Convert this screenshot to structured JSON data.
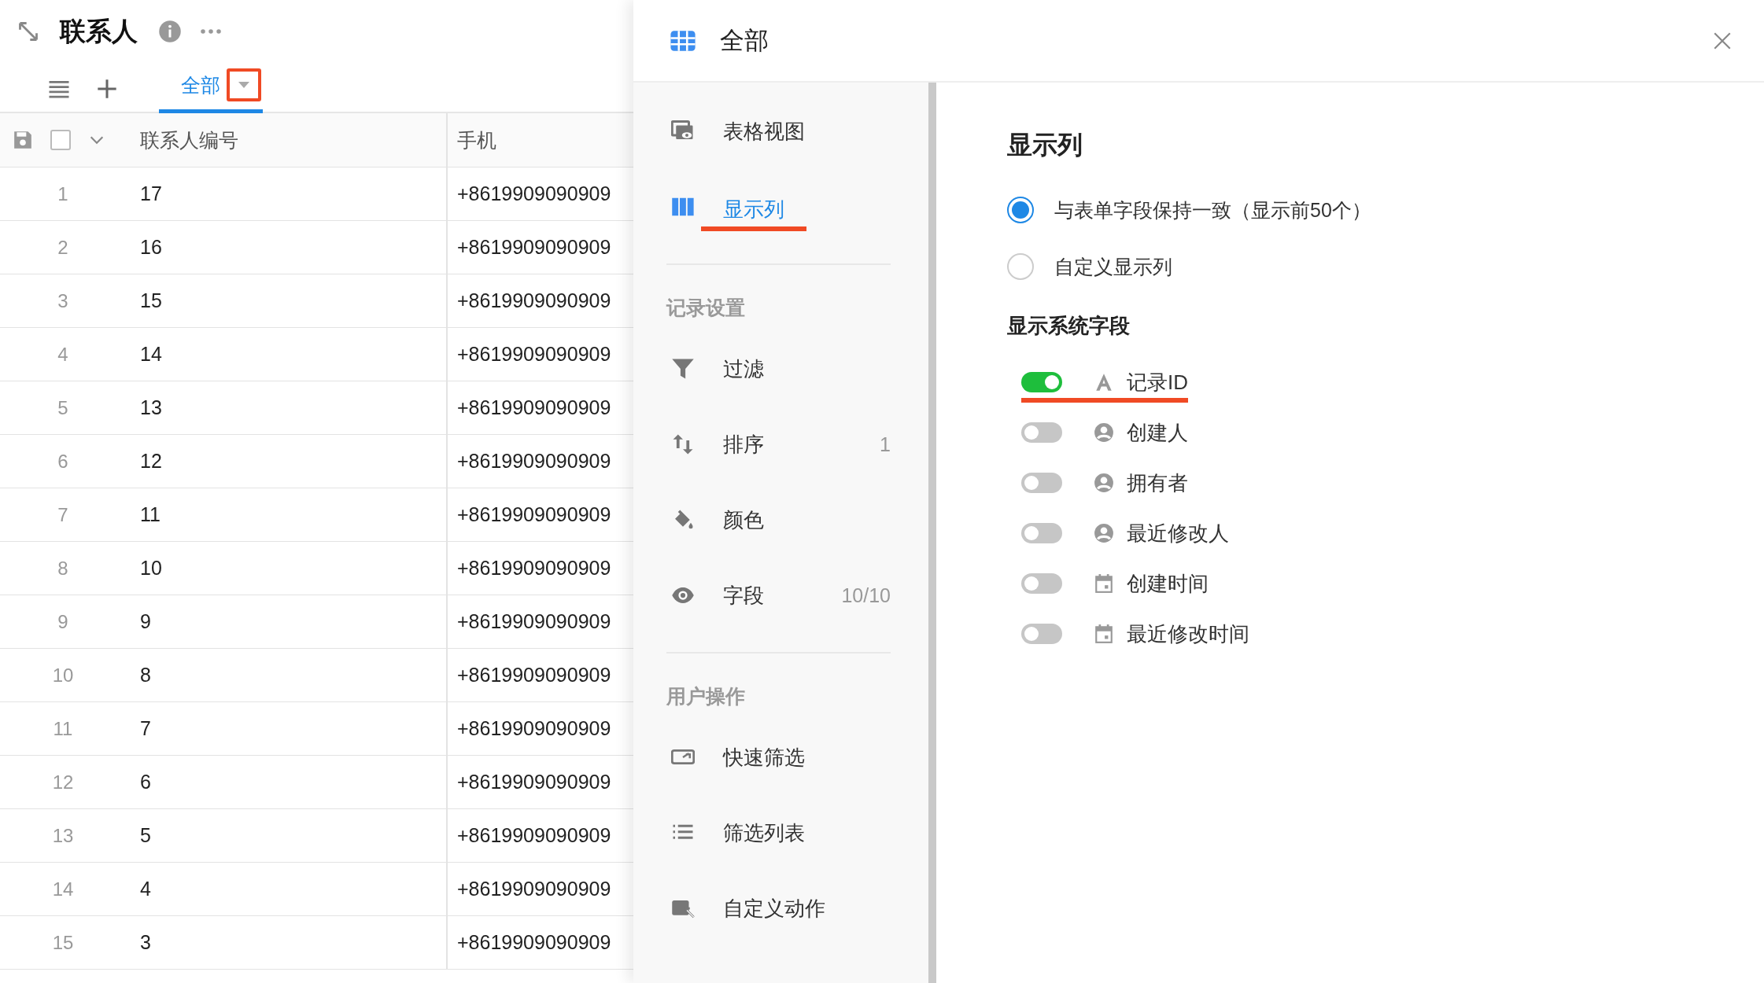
{
  "header": {
    "title": "联系人"
  },
  "view_tabs": [
    {
      "label": "全部",
      "selected": true,
      "highlighted": true
    }
  ],
  "table": {
    "select_all": {
      "checked": false
    },
    "columns": [
      "联系人编号",
      "手机"
    ],
    "rows": [
      {
        "index": "1",
        "number": "17",
        "phone": "+8619909090909"
      },
      {
        "index": "2",
        "number": "16",
        "phone": "+8619909090909"
      },
      {
        "index": "3",
        "number": "15",
        "phone": "+8619909090909"
      },
      {
        "index": "4",
        "number": "14",
        "phone": "+8619909090909"
      },
      {
        "index": "5",
        "number": "13",
        "phone": "+8619909090909"
      },
      {
        "index": "6",
        "number": "12",
        "phone": "+8619909090909"
      },
      {
        "index": "7",
        "number": "11",
        "phone": "+8619909090909"
      },
      {
        "index": "8",
        "number": "10",
        "phone": "+8619909090909"
      },
      {
        "index": "9",
        "number": "9",
        "phone": "+8619909090909"
      },
      {
        "index": "10",
        "number": "8",
        "phone": "+8619909090909"
      },
      {
        "index": "11",
        "number": "7",
        "phone": "+8619909090909"
      },
      {
        "index": "12",
        "number": "6",
        "phone": "+8619909090909"
      },
      {
        "index": "13",
        "number": "5",
        "phone": "+8619909090909"
      },
      {
        "index": "14",
        "number": "4",
        "phone": "+8619909090909"
      },
      {
        "index": "15",
        "number": "3",
        "phone": "+8619909090909"
      }
    ]
  },
  "drawer": {
    "title": "全部",
    "nav": [
      {
        "kind": "item",
        "label": "表格视图",
        "selected": false,
        "highlighted": false
      },
      {
        "kind": "item",
        "label": "显示列",
        "selected": true,
        "highlighted": true
      },
      {
        "kind": "divider"
      },
      {
        "kind": "section",
        "label": "记录设置"
      },
      {
        "kind": "item",
        "label": "过滤",
        "selected": false,
        "highlighted": false
      },
      {
        "kind": "item",
        "label": "排序",
        "count": "1",
        "selected": false,
        "highlighted": false
      },
      {
        "kind": "item",
        "label": "颜色",
        "selected": false,
        "highlighted": false
      },
      {
        "kind": "item",
        "label": "字段",
        "count": "10/10",
        "selected": false,
        "highlighted": false
      },
      {
        "kind": "divider"
      },
      {
        "kind": "section",
        "label": "用户操作"
      },
      {
        "kind": "item",
        "label": "快速筛选",
        "selected": false,
        "highlighted": false
      },
      {
        "kind": "item",
        "label": "筛选列表",
        "selected": false,
        "highlighted": false
      },
      {
        "kind": "item",
        "label": "自定义动作",
        "selected": false,
        "highlighted": false
      }
    ],
    "display": {
      "heading": "显示列",
      "options": [
        {
          "label": "与表单字段保持一致（显示前50个）",
          "selected": true
        },
        {
          "label": "自定义显示列",
          "selected": false
        }
      ],
      "system_heading": "显示系统字段",
      "fields": [
        {
          "kind": "text",
          "label": "记录ID",
          "on": true,
          "highlighted": true
        },
        {
          "kind": "user",
          "label": "创建人",
          "on": false,
          "highlighted": false
        },
        {
          "kind": "user",
          "label": "拥有者",
          "on": false,
          "highlighted": false
        },
        {
          "kind": "user",
          "label": "最近修改人",
          "on": false,
          "highlighted": false
        },
        {
          "kind": "date",
          "label": "创建时间",
          "on": false,
          "highlighted": false
        },
        {
          "kind": "date",
          "label": "最近修改时间",
          "on": false,
          "highlighted": false
        }
      ]
    }
  }
}
